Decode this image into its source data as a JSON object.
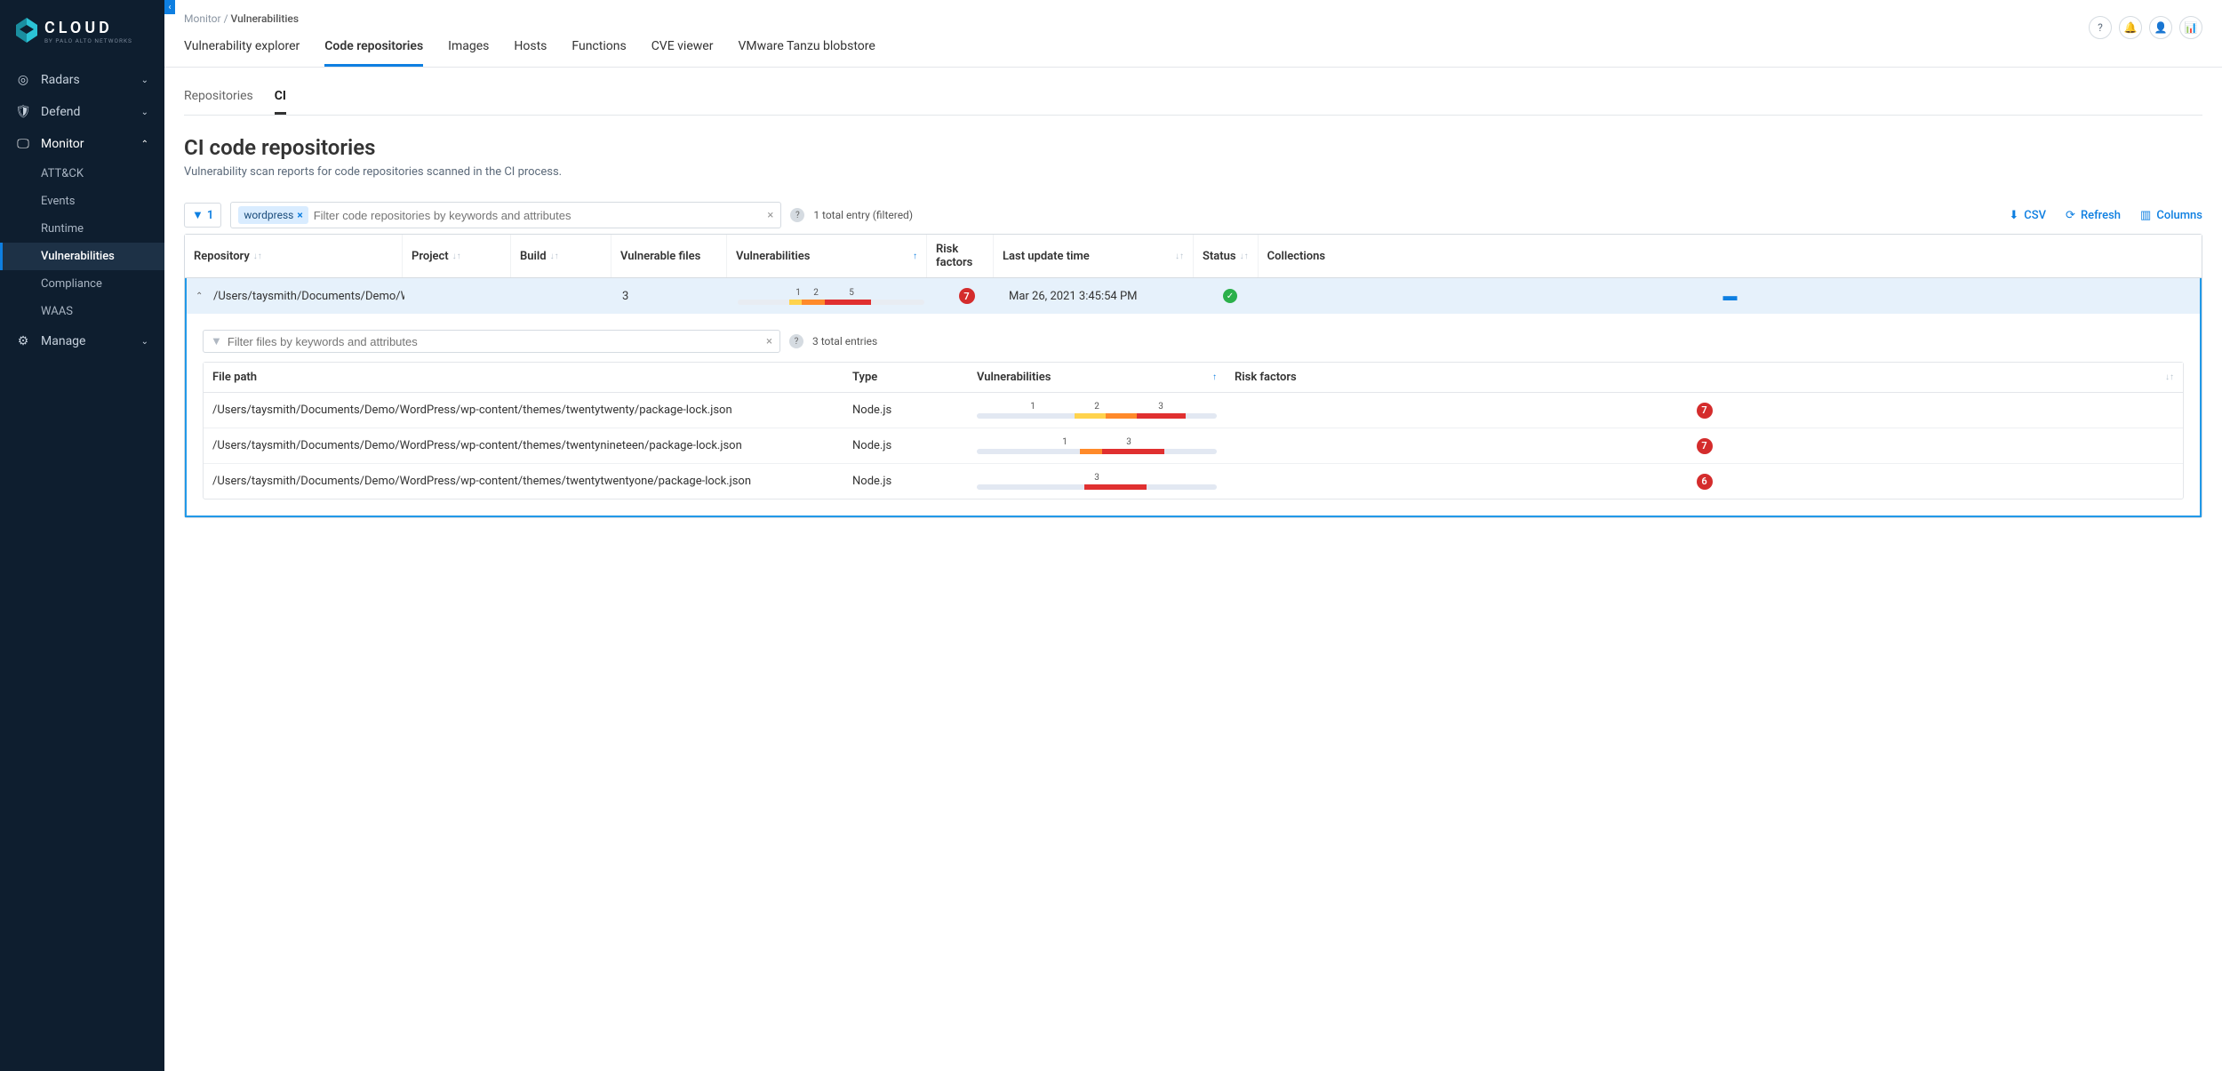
{
  "logo": {
    "brand": "CLOUD",
    "tag": "BY PALO ALTO NETWORKS"
  },
  "sidebar": {
    "items": [
      {
        "label": "Radars"
      },
      {
        "label": "Defend"
      },
      {
        "label": "Monitor",
        "expanded": true,
        "children": [
          {
            "label": "ATT&CK"
          },
          {
            "label": "Events"
          },
          {
            "label": "Runtime"
          },
          {
            "label": "Vulnerabilities",
            "active": true
          },
          {
            "label": "Compliance"
          },
          {
            "label": "WAAS"
          }
        ]
      },
      {
        "label": "Manage"
      }
    ]
  },
  "breadcrumb": {
    "parent": "Monitor",
    "current": "Vulnerabilities"
  },
  "tabs": [
    {
      "label": "Vulnerability explorer"
    },
    {
      "label": "Code repositories",
      "active": true
    },
    {
      "label": "Images"
    },
    {
      "label": "Hosts"
    },
    {
      "label": "Functions"
    },
    {
      "label": "CVE viewer"
    },
    {
      "label": "VMware Tanzu blobstore"
    }
  ],
  "sub_tabs": [
    {
      "label": "Repositories"
    },
    {
      "label": "CI",
      "active": true
    }
  ],
  "page": {
    "title": "CI code repositories",
    "desc": "Vulnerability scan reports for code repositories scanned in the CI process."
  },
  "filter": {
    "count": "1",
    "chip": "wordpress",
    "placeholder": "Filter code repositories by keywords and attributes",
    "total": "1 total entry (filtered)",
    "detail_placeholder": "Filter files by keywords and attributes",
    "detail_total": "3 total entries"
  },
  "actions": {
    "csv": "CSV",
    "refresh": "Refresh",
    "columns": "Columns"
  },
  "columns": {
    "repo": "Repository",
    "project": "Project",
    "build": "Build",
    "vfiles": "Vulnerable files",
    "vulns": "Vulnerabilities",
    "risk": "Risk factors",
    "time": "Last update time",
    "status": "Status",
    "coll": "Collections"
  },
  "row": {
    "repo": "/Users/taysmith/Documents/Demo/W...",
    "vfiles": "3",
    "vuln_labels": [
      "1",
      "2",
      "5"
    ],
    "risk": "7",
    "time": "Mar 26, 2021 3:45:54 PM"
  },
  "detail_columns": {
    "path": "File path",
    "type": "Type",
    "vulns": "Vulnerabilities",
    "risk": "Risk factors"
  },
  "detail_rows": [
    {
      "path": "/Users/taysmith/Documents/Demo/WordPress/wp-content/themes/twentytwenty/package-lock.json",
      "type": "Node.js",
      "labels": [
        "1",
        "2",
        "3"
      ],
      "segs": [
        14,
        14,
        22
      ],
      "risk": "7"
    },
    {
      "path": "/Users/taysmith/Documents/Demo/WordPress/wp-content/themes/twentynineteen/package-lock.json",
      "type": "Node.js",
      "labels": [
        "1",
        "3"
      ],
      "segs": [
        0,
        10,
        28
      ],
      "risk": "7"
    },
    {
      "path": "/Users/taysmith/Documents/Demo/WordPress/wp-content/themes/twentytwentyone/package-lock.json",
      "type": "Node.js",
      "labels": [
        "3"
      ],
      "segs": [
        0,
        0,
        28
      ],
      "risk": "6"
    }
  ]
}
